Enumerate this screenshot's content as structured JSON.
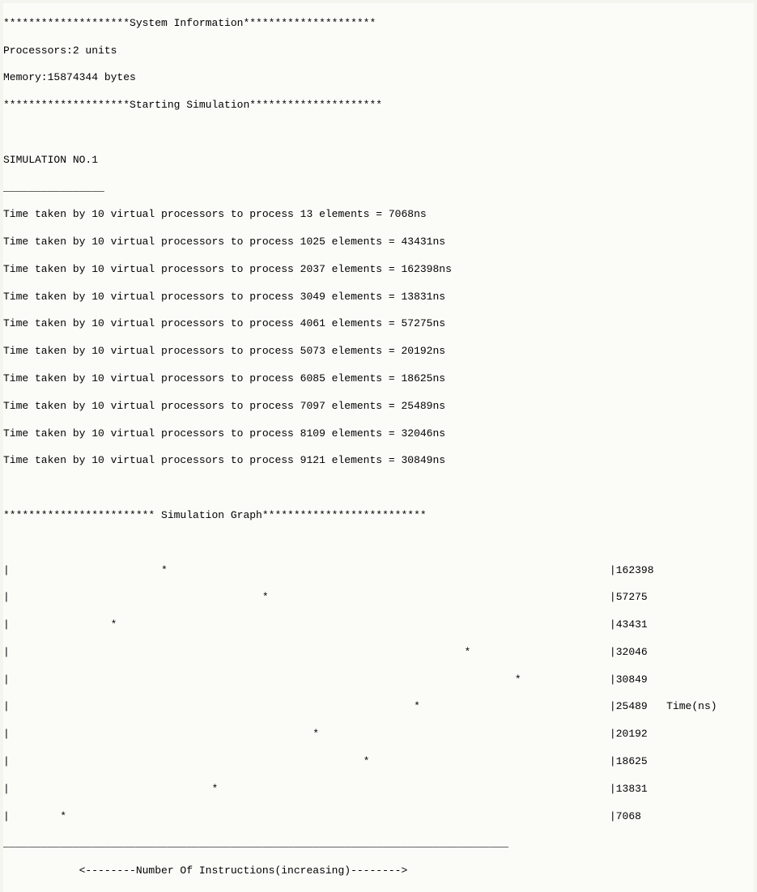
{
  "header": {
    "sysinfo_line": "********************System Information*********************",
    "processors_label": "Processors:",
    "processors_value": "2 units",
    "memory_label": "Memory:",
    "memory_value": "15874344 bytes",
    "start_line": "********************Starting Simulation*********************"
  },
  "simulation": {
    "title": "SIMULATION NO.1",
    "underline": "________________",
    "lines": [
      "Time taken by 10 virtual processors to process 13 elements = 7068ns",
      "Time taken by 10 virtual processors to process 1025 elements = 43431ns",
      "Time taken by 10 virtual processors to process 2037 elements = 162398ns",
      "Time taken by 10 virtual processors to process 3049 elements = 13831ns",
      "Time taken by 10 virtual processors to process 4061 elements = 57275ns",
      "Time taken by 10 virtual processors to process 5073 elements = 20192ns",
      "Time taken by 10 virtual processors to process 6085 elements = 18625ns",
      "Time taken by 10 virtual processors to process 7097 elements = 25489ns",
      "Time taken by 10 virtual processors to process 8109 elements = 32046ns",
      "Time taken by 10 virtual processors to process 9121 elements = 30849ns"
    ]
  },
  "graph": {
    "title": "************************ Simulation Graph**************************",
    "rows": [
      "|                        *                                                                      |162398",
      "|                                        *                                                      |57275",
      "|                *                                                                              |43431",
      "|                                                                        *                      |32046",
      "|                                                                                *              |30849",
      "|                                                                *                              |25489   Time(ns)",
      "|                                                *                                              |20192",
      "|                                                        *                                      |18625",
      "|                                *                                                              |13831",
      "|        *                                                                                      |7068"
    ],
    "separator": "________________________________________________________________________________",
    "xaxis": "            <--------Number Of Instructions(increasing)-------->"
  },
  "chart_data": {
    "type": "scatter",
    "title": "Simulation Graph",
    "xlabel": "Number Of Instructions (increasing)",
    "ylabel": "Time(ns)",
    "x": [
      13,
      1025,
      2037,
      3049,
      4061,
      5073,
      6085,
      7097,
      8109,
      9121
    ],
    "y": [
      7068,
      43431,
      162398,
      13831,
      57275,
      20192,
      18625,
      25489,
      32046,
      30849
    ],
    "ylim": [
      0,
      162398
    ],
    "row_values_desc": [
      162398,
      57275,
      43431,
      32046,
      30849,
      25489,
      20192,
      18625,
      13831,
      7068
    ]
  }
}
